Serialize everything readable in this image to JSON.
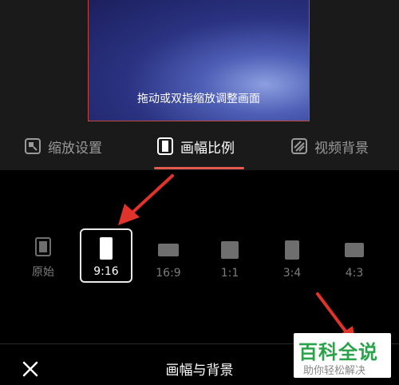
{
  "preview": {
    "hint": "拖动或双指缩放调整画面"
  },
  "tabs": [
    {
      "label": "缩放设置",
      "icon": "zoom-settings-icon",
      "active": false
    },
    {
      "label": "画幅比例",
      "icon": "aspect-ratio-icon",
      "active": true
    },
    {
      "label": "视频背景",
      "icon": "video-background-icon",
      "active": false
    }
  ],
  "ratios": [
    {
      "label": "原始",
      "selected": false
    },
    {
      "label": "9:16",
      "selected": true
    },
    {
      "label": "16:9",
      "selected": false
    },
    {
      "label": "1:1",
      "selected": false
    },
    {
      "label": "3:4",
      "selected": false
    },
    {
      "label": "4:3",
      "selected": false
    }
  ],
  "bottom": {
    "title": "画幅与背景",
    "close_icon": "close-icon"
  },
  "watermark": {
    "title": "百科全说",
    "subtitle": "助你轻松解决"
  },
  "colors": {
    "accent": "#e35a4f",
    "annotation_arrow": "#e0332b",
    "background": "#000000",
    "watermark_green": "#2aa34a"
  }
}
